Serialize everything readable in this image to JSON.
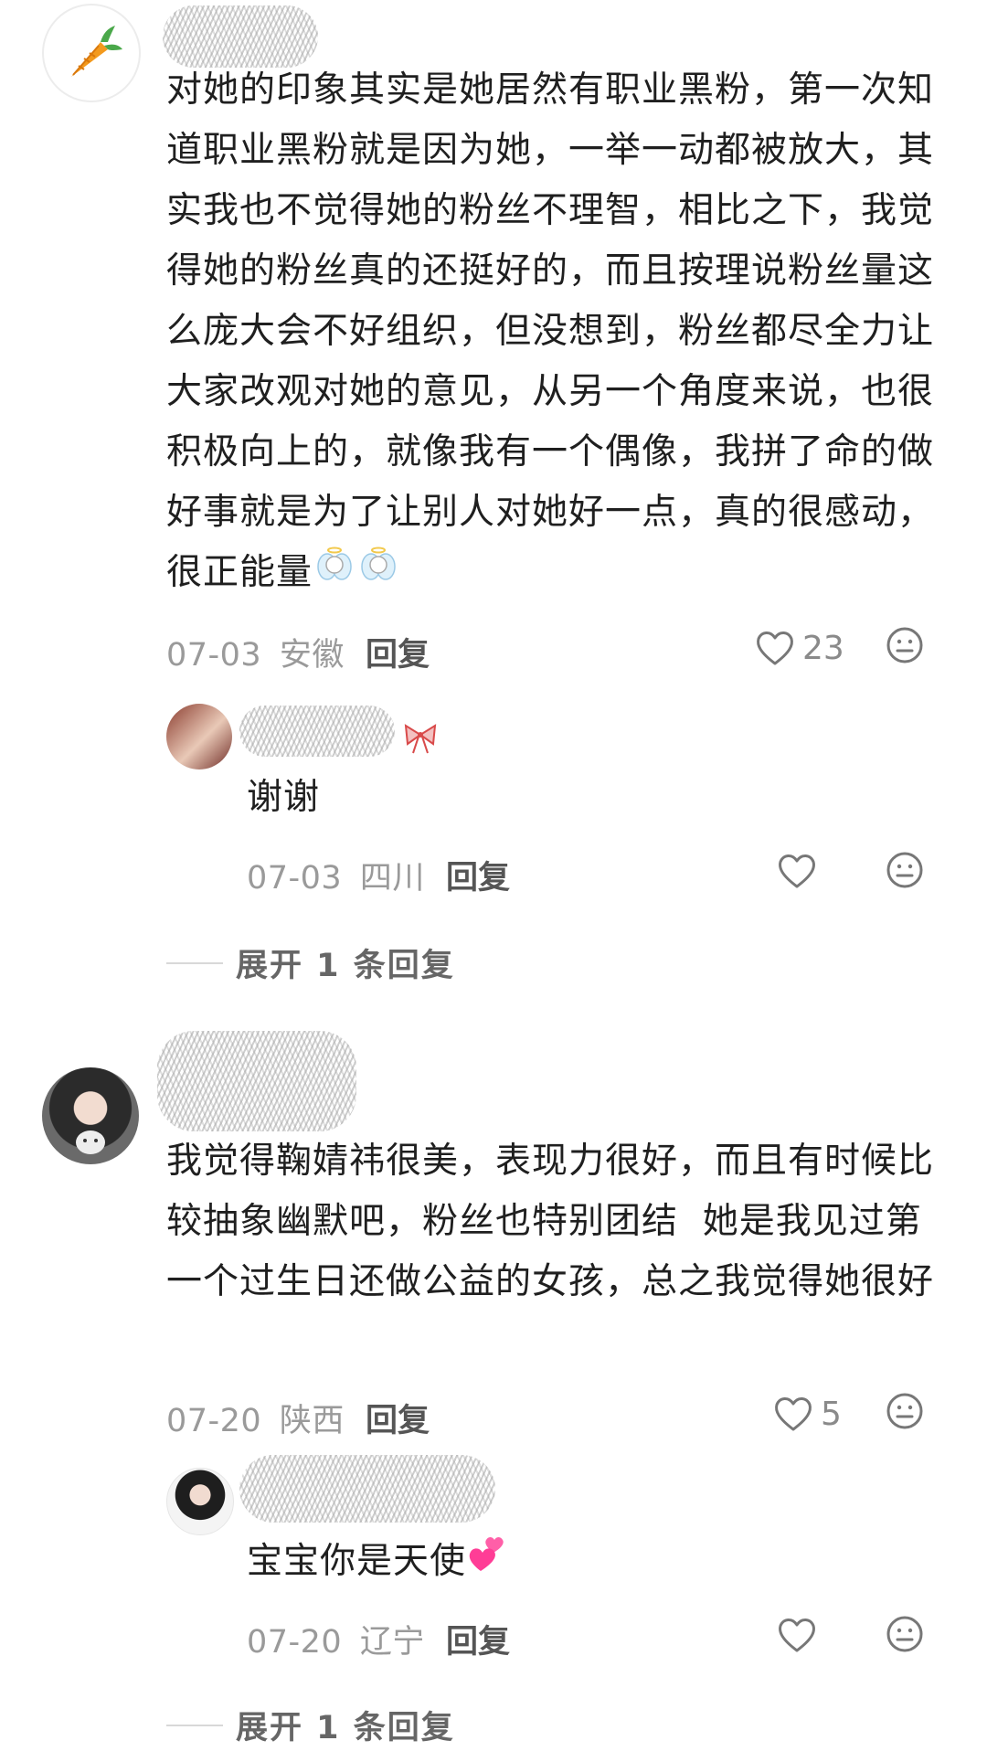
{
  "comments": [
    {
      "text": "对她的印象其实是她居然有职业黑粉，第一次知道职业黑粉就是因为她，一举一动都被放大，其实我也不觉得她的粉丝不理智，相比之下，我觉得她的粉丝真的还挺好的，而且按理说粉丝量这么庞大会不好组织，但没想到，粉丝都尽全力让大家改观对她的意见，从另一个角度来说，也很积极向上的，就像我有一个偶像，我拼了命的做好事就是为了让别人对她好一点，真的很感动，很正能量",
      "date": "07-03",
      "location": "安徽",
      "reply_label": "回复",
      "likes": "23",
      "inline_emoji": "angel-emoji",
      "replies": [
        {
          "text": "谢谢",
          "date": "07-03",
          "location": "四川",
          "reply_label": "回复"
        }
      ],
      "expand_label": "展开 1 条回复"
    },
    {
      "text": "我觉得鞠婧祎很美，表现力很好，而且有时候比较抽象幽默吧，粉丝也特别团结  她是我见过第一个过生日还做公益的女孩，总之我觉得她很好",
      "date": "07-20",
      "location": "陕西",
      "reply_label": "回复",
      "likes": "5",
      "replies": [
        {
          "text": "宝宝你是天使",
          "date": "07-20",
          "location": "辽宁",
          "reply_label": "回复",
          "inline_emoji": "two-hearts-emoji"
        }
      ],
      "expand_label": "展开 1 条回复"
    }
  ],
  "colors": {
    "text": "#1f1f1f",
    "meta": "#9a9a9a",
    "reply": "#555555",
    "icon": "#777777"
  }
}
